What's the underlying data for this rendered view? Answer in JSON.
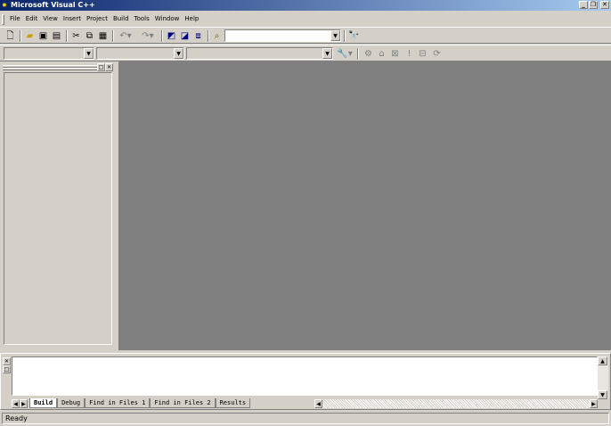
{
  "window": {
    "title": "Microsoft Visual C++",
    "app_icon": "vc-icon",
    "caption_buttons": [
      "minimize",
      "maximize",
      "close"
    ]
  },
  "menu": {
    "items": [
      "File",
      "Edit",
      "View",
      "Insert",
      "Project",
      "Build",
      "Tools",
      "Window",
      "Help"
    ]
  },
  "toolbar": {
    "standard_icons": [
      "new-text-file-icon",
      "open-icon",
      "save-icon",
      "save-all-icon",
      "cut-icon",
      "copy-icon",
      "paste-icon",
      "undo-icon",
      "redo-icon",
      "workspace-icon",
      "output-icon",
      "window-list-icon",
      "find-in-files-icon",
      "find-combo",
      "search-icon"
    ],
    "find_value": ""
  },
  "wizardbar": {
    "class_combo": "",
    "filter_combo": "",
    "members_combo": "",
    "icons": [
      "wizard-action-icon",
      "compile-icon",
      "build-icon",
      "stop-build-icon",
      "execute-icon",
      "insert-breakpoint-icon",
      "go-icon"
    ]
  },
  "output": {
    "tabs": [
      "Build",
      "Debug",
      "Find in Files 1",
      "Find in Files 2",
      "Results"
    ],
    "active_tab": "Build"
  },
  "status": {
    "text": "Ready"
  },
  "colors": {
    "face": "#d4d0c8",
    "mdi_background": "#808080",
    "title_start": "#0a246a",
    "title_end": "#a6caf0"
  }
}
